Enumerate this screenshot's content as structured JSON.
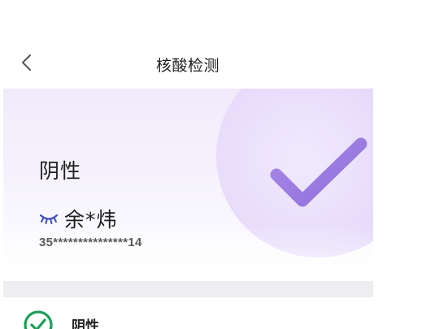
{
  "nav": {
    "title": "核酸检测",
    "back_icon": "chevron-left-icon"
  },
  "result_card": {
    "result_label": "阴性",
    "name": "余*炜",
    "id_number": "35***************14",
    "eye_icon": "eye-closed-icon",
    "check_icon": "checkmark-icon"
  },
  "detail": {
    "status_icon": "check-circle-icon",
    "status_label": "阴性"
  },
  "colors": {
    "accent_purple": "#9b7ce0",
    "status_green": "#1f9d5a",
    "eye_blue": "#3d4fc4"
  }
}
